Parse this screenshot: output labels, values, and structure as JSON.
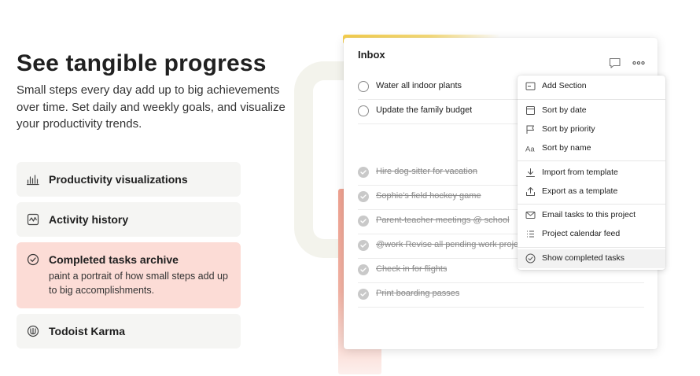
{
  "hero": {
    "title": "See tangible progress",
    "description": "Small steps every day add up to big achievements over time. Set daily and weekly goals, and visualize your productivity trends."
  },
  "features": [
    {
      "title": "Productivity visualizations",
      "icon": "bar-chart-icon"
    },
    {
      "title": "Activity history",
      "icon": "activity-icon"
    },
    {
      "title": "Completed tasks archive",
      "icon": "check-circle-icon",
      "description": "paint a portrait of how small steps add up to big accomplishments.",
      "active": true
    },
    {
      "title": "Todoist Karma",
      "icon": "karma-icon"
    }
  ],
  "inbox": {
    "title": "Inbox",
    "open_tasks": [
      "Water all indoor plants",
      "Update the family budget"
    ],
    "completed_tasks": [
      "Hire dog-sitter for vacation",
      "Sophie's field hockey game",
      "Parent-teacher meetings @ school",
      "@work Revise all pending work proje",
      "Check in for flights",
      "Print boarding passes"
    ]
  },
  "menu": {
    "items": [
      {
        "label": "Add Section",
        "icon": "section-icon"
      },
      {
        "label": "Sort by date",
        "icon": "calendar-icon"
      },
      {
        "label": "Sort by priority",
        "icon": "flag-icon"
      },
      {
        "label": "Sort by name",
        "icon": "text-icon"
      },
      {
        "label": "Import from template",
        "icon": "import-icon"
      },
      {
        "label": "Export as a template",
        "icon": "export-icon"
      },
      {
        "label": "Email tasks to this project",
        "icon": "email-icon"
      },
      {
        "label": "Project calendar feed",
        "icon": "list-icon"
      },
      {
        "label": "Show completed tasks",
        "icon": "check-circle-icon",
        "selected": true
      }
    ]
  },
  "colors": {
    "active_feature_bg": "#fcdcd6",
    "feature_bg": "#f5f5f3",
    "accent_yellow": "#f6cf4d",
    "accent_red": "#f0a291"
  }
}
